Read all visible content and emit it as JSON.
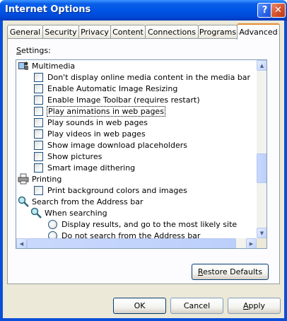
{
  "window": {
    "title": "Internet Options"
  },
  "titlebar_buttons": {
    "help": "?",
    "close": "✕"
  },
  "tabs": [
    {
      "label": "General"
    },
    {
      "label": "Security"
    },
    {
      "label": "Privacy"
    },
    {
      "label": "Content"
    },
    {
      "label": "Connections"
    },
    {
      "label": "Programs"
    },
    {
      "label": "Advanced",
      "active": true
    }
  ],
  "settings": {
    "label_first": "S",
    "label_rest": "ettings:",
    "items": [
      {
        "type": "group",
        "icon": "multimedia-icon",
        "label": "Multimedia"
      },
      {
        "type": "checkbox",
        "checked": false,
        "label": "Don't display online media content in the media bar"
      },
      {
        "type": "checkbox",
        "checked": false,
        "label": "Enable Automatic Image Resizing"
      },
      {
        "type": "checkbox",
        "checked": false,
        "label": "Enable Image Toolbar (requires restart)"
      },
      {
        "type": "checkbox",
        "checked": false,
        "label": "Play animations in web pages",
        "focused": true
      },
      {
        "type": "checkbox",
        "checked": false,
        "label": "Play sounds in web pages"
      },
      {
        "type": "checkbox",
        "checked": false,
        "label": "Play videos in web pages"
      },
      {
        "type": "checkbox",
        "checked": false,
        "label": "Show image download placeholders"
      },
      {
        "type": "checkbox",
        "checked": false,
        "label": "Show pictures"
      },
      {
        "type": "checkbox",
        "checked": false,
        "label": "Smart image dithering"
      },
      {
        "type": "group",
        "icon": "printer-icon",
        "label": "Printing"
      },
      {
        "type": "checkbox",
        "checked": false,
        "label": "Print background colors and images"
      },
      {
        "type": "group",
        "icon": "search-icon",
        "label": "Search from the Address bar"
      },
      {
        "type": "subgroup",
        "icon": "search-icon",
        "label": "When searching"
      },
      {
        "type": "radio",
        "checked": false,
        "label": "Display results, and go to the most likely site"
      },
      {
        "type": "radio",
        "checked": false,
        "label": "Do not search from the Address bar"
      }
    ]
  },
  "buttons": {
    "restore_first": "R",
    "restore_rest": "estore Defaults",
    "ok": "OK",
    "cancel": "Cancel",
    "apply_first": "A",
    "apply_rest": "pply"
  },
  "colors": {
    "title_blue": "#0055e5",
    "face": "#ece9d8",
    "selection": "#316ac5"
  }
}
